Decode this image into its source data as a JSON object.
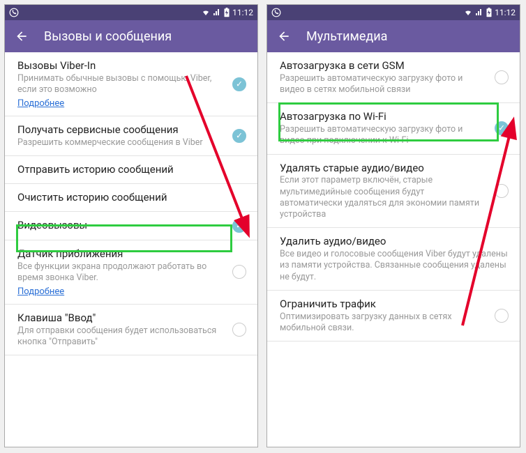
{
  "statusbar": {
    "time": "11:12"
  },
  "left": {
    "title": "Вызовы и сообщения",
    "items": [
      {
        "title": "Вызовы Viber-In",
        "desc": "Принимать обычные вызовы с помощью Viber, если это возможно",
        "link": "Подробнее",
        "state": "on"
      },
      {
        "title": "Получать сервисные сообщения",
        "desc": "Разрешить коммерческие сообщения в Viber",
        "state": "on"
      },
      {
        "title": "Отправить историю сообщений",
        "state": "none"
      },
      {
        "title": "Очистить историю сообщений",
        "state": "none"
      },
      {
        "title": "Видеовызовы",
        "state": "on"
      },
      {
        "title": "Датчик приближения",
        "desc": "Все функции экрана продолжают работать во время звонка Viber.",
        "link": "Подробнее",
        "state": "off"
      },
      {
        "title": "Клавиша \"Ввод\"",
        "desc": "Для отправки сообщения будет использоваться кнопка \"Отправить\"",
        "state": "off"
      }
    ]
  },
  "right": {
    "title": "Мультимедиа",
    "items": [
      {
        "title": "Автозагрузка в сети GSM",
        "desc": "Разрешить автоматическую загрузку фото и видео в сетях мобильной связи",
        "state": "off"
      },
      {
        "title": "Автозагрузка по Wi-Fi",
        "desc": "Разрешить автоматическую загрузку фото и видео при подключении к Wi-Fi",
        "state": "on"
      },
      {
        "title": "Удалять старые аудио/видео",
        "desc": "Если этот параметр включён, старые мультимедийные сообщения будут автоматически удаляться для экономии памяти устройства",
        "state": "off"
      },
      {
        "title": "Удалить аудио/видео",
        "desc": "Все видео и голосовые сообщения Viber будут удалены из памяти устройства. Связанные сообщения удалены не будут.",
        "state": "none"
      },
      {
        "title": "Ограничить трафик",
        "desc": "Оптимизировать загрузку данных в сетях мобильной связи.",
        "state": "off"
      }
    ]
  }
}
